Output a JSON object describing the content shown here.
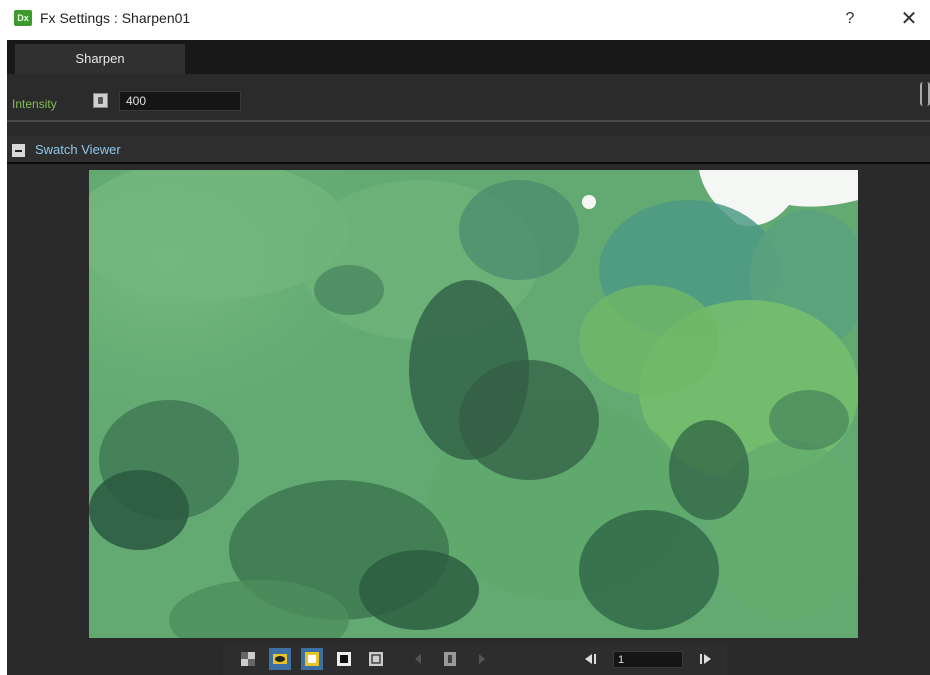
{
  "window": {
    "title": "Fx Settings : Sharpen01",
    "icon_label": "Dx",
    "help_label": "?",
    "close_label": "✕"
  },
  "tabs": [
    {
      "label": "Sharpen",
      "active": true
    }
  ],
  "params": {
    "intensity": {
      "label": "Intensity",
      "value": "400"
    }
  },
  "swatch_viewer": {
    "title": "Swatch Viewer",
    "collapsed": false
  },
  "toolbar": {
    "buttons": [
      {
        "name": "checkerboard-bg-icon",
        "active": false
      },
      {
        "name": "eye-preview-icon",
        "active": true
      },
      {
        "name": "white-bg-icon",
        "active": true
      },
      {
        "name": "black-bg-icon",
        "active": false
      },
      {
        "name": "fit-to-window-icon",
        "active": false
      },
      {
        "name": "prev-key-icon",
        "active": false
      },
      {
        "name": "key-toggle-icon",
        "active": false
      },
      {
        "name": "next-key-icon",
        "active": false
      },
      {
        "name": "prev-frame-icon",
        "active": false
      },
      {
        "name": "next-frame-icon",
        "active": false
      }
    ],
    "frame": "1"
  },
  "colors": {
    "accent_green": "#7fbf52",
    "section_blue": "#8ec8e8",
    "active_button": "#3d6fa3",
    "panel_bg": "#2a2a2a"
  }
}
